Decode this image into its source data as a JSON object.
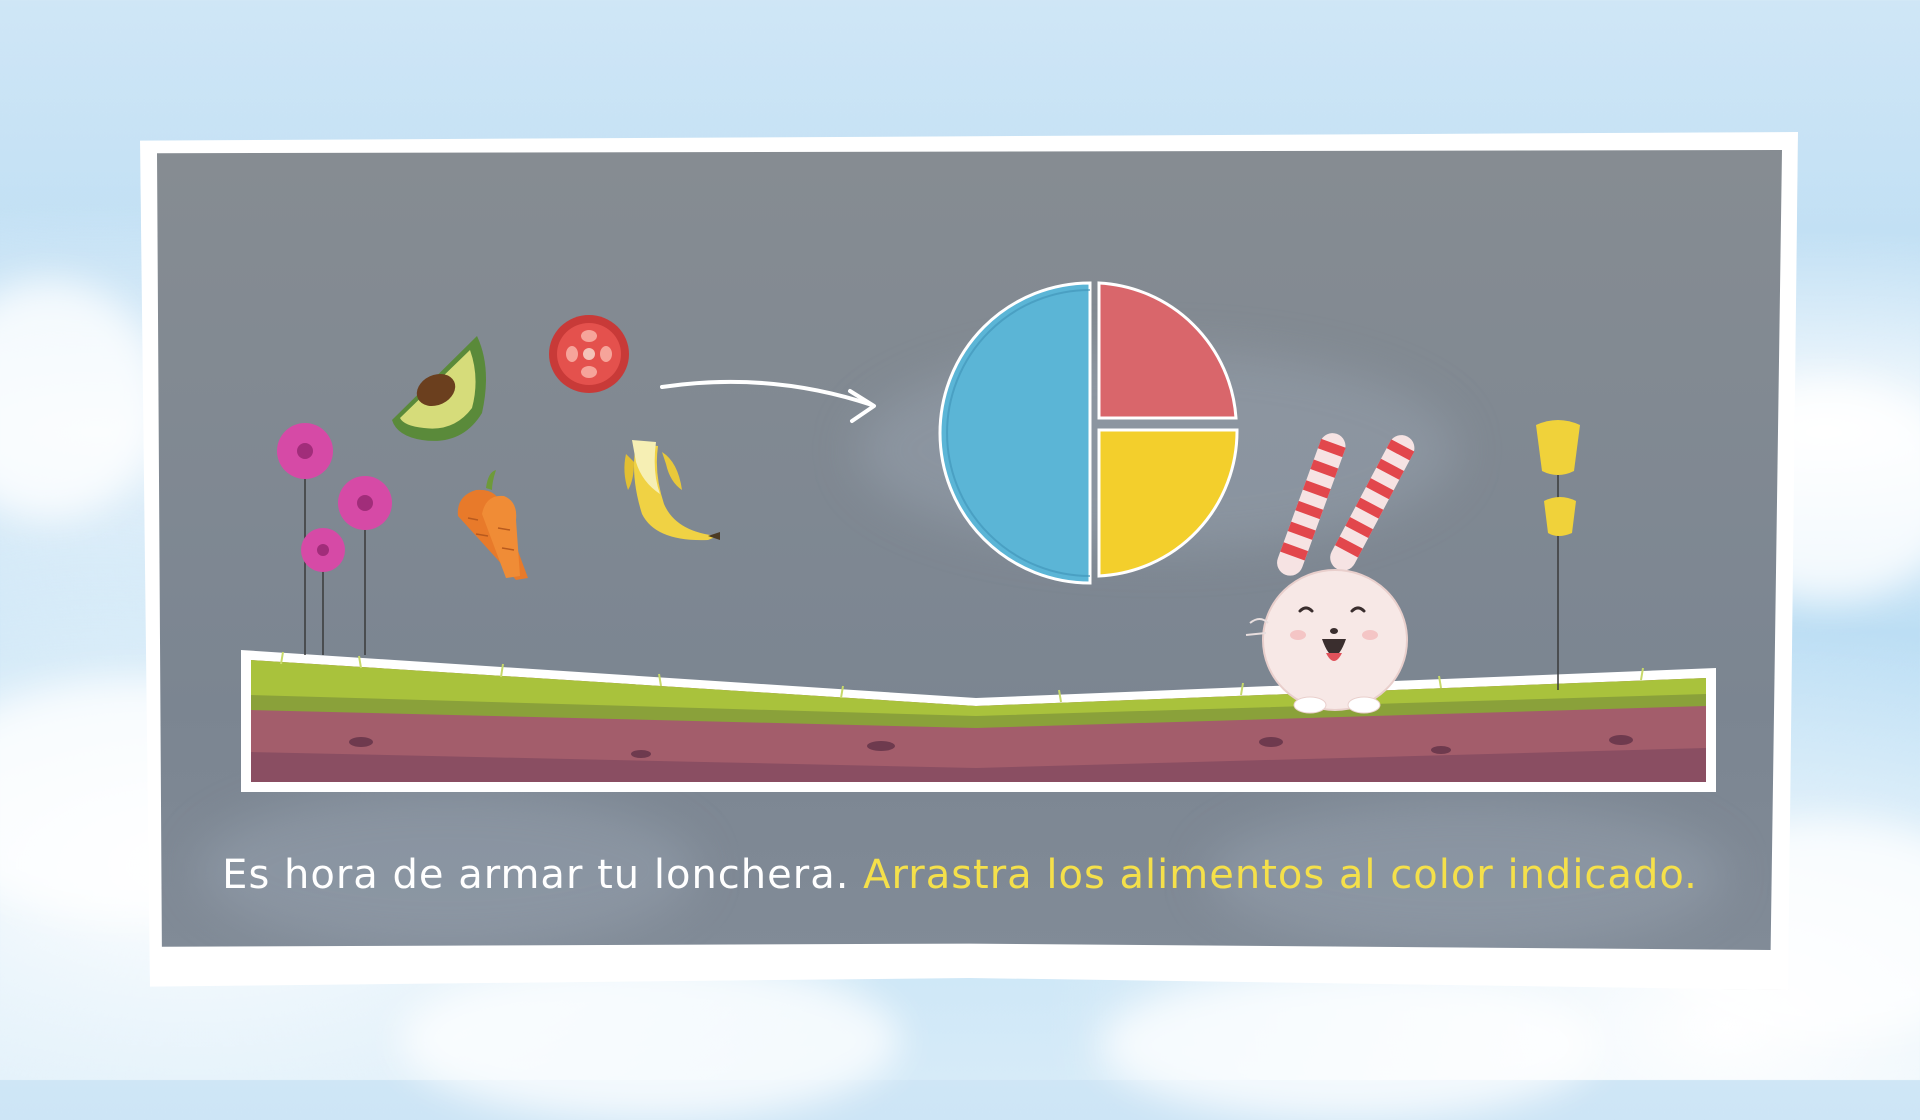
{
  "scene": {
    "colors": {
      "sky": "#bfe0f5",
      "board": "#818b97",
      "frame": "#ffffff",
      "plate_blue": "#5bb5d6",
      "plate_red": "#d9666b",
      "plate_yellow": "#f3cf2c",
      "grass": "#a9c23c",
      "soil": "#a35d6b",
      "instruction_white": "#ffffff",
      "instruction_yellow": "#f5e04a"
    },
    "foods": [
      {
        "name": "avocado",
        "icon": "avocado-icon"
      },
      {
        "name": "tomato",
        "icon": "tomato-icon"
      },
      {
        "name": "carrot",
        "icon": "carrot-icon"
      },
      {
        "name": "banana",
        "icon": "banana-icon"
      }
    ]
  },
  "instruction": {
    "part1": "Es hora de armar tu lonchera.",
    "part2": "Arrastra los alimentos al color indicado."
  }
}
